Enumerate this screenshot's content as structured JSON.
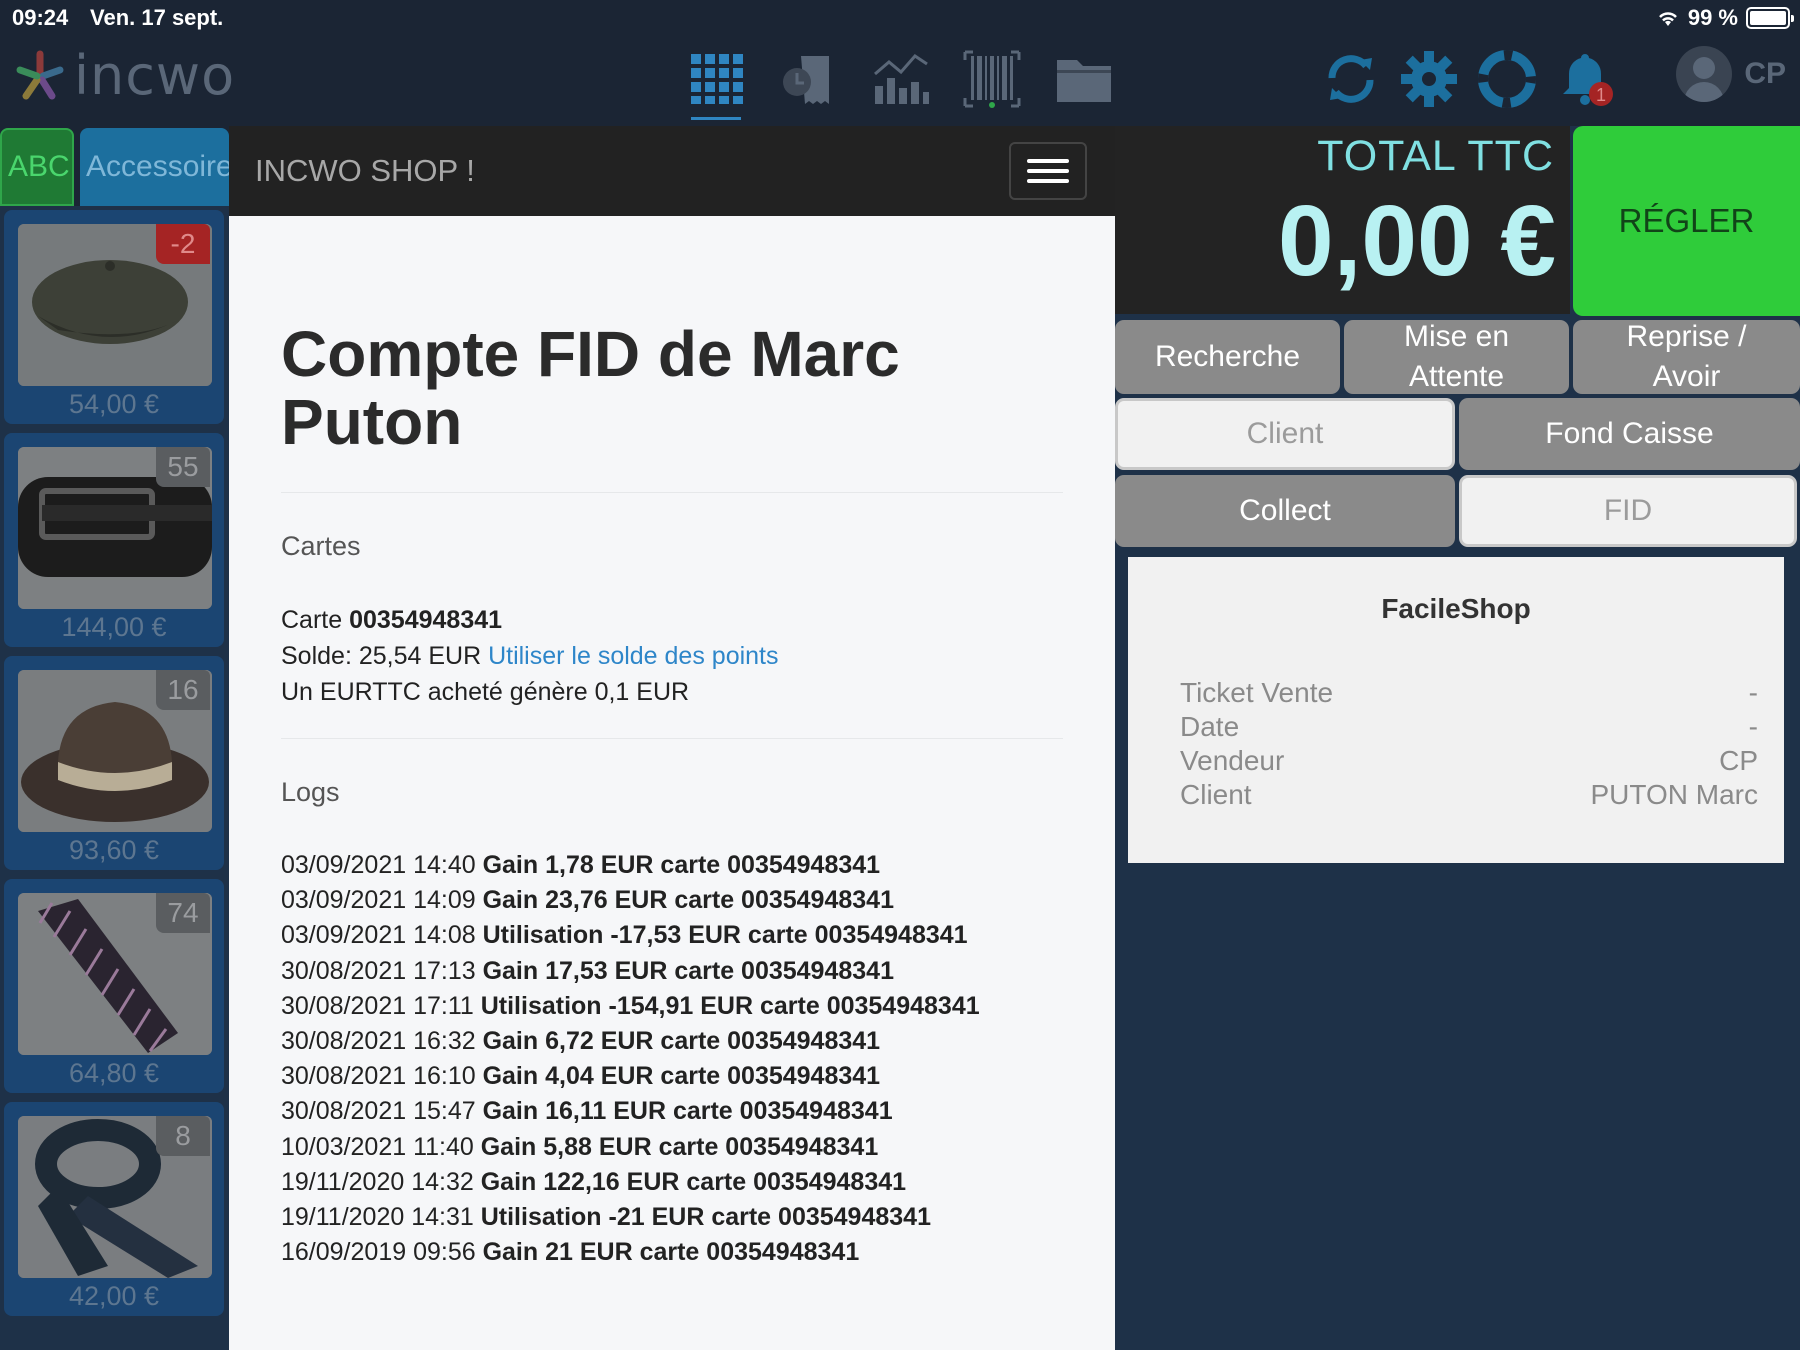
{
  "status_bar": {
    "time": "09:24",
    "date": "Ven. 17 sept.",
    "battery": "99 %"
  },
  "app": {
    "logo": "incwo",
    "user_initials": "CP",
    "notification_count": "1"
  },
  "nav_icons": [
    "grid-icon",
    "clock-receipt-icon",
    "chart-icon",
    "barcode-icon",
    "folder-icon"
  ],
  "right_icons": [
    "sync-icon",
    "gear-icon",
    "lifebuoy-icon",
    "bell-icon"
  ],
  "categories": {
    "abc": "ABC",
    "accessories": "Accessoires"
  },
  "products": [
    {
      "badge": "-2",
      "price": "54,00 €",
      "image": "cap"
    },
    {
      "badge": "55",
      "price": "144,00 €",
      "image": "belt"
    },
    {
      "badge": "16",
      "price": "93,60 €",
      "image": "hat"
    },
    {
      "badge": "74",
      "price": "64,80 €",
      "image": "tie"
    },
    {
      "badge": "8",
      "price": "42,00 €",
      "image": "scarf"
    }
  ],
  "shop_header": {
    "title": "INCWO SHOP !"
  },
  "fid": {
    "title": "Compte FID de Marc Puton",
    "cards_label": "Cartes",
    "card_prefix": "Carte ",
    "card_number": "00354948341",
    "balance_text": "Solde: 25,54 EUR ",
    "use_points_link": "Utiliser le solde des points",
    "rule": "Un EURTTC acheté génère 0,1 EUR",
    "logs_label": "Logs",
    "logs": [
      {
        "date": "03/09/2021 14:40 ",
        "text": "Gain 1,78 EUR carte 00354948341"
      },
      {
        "date": "03/09/2021 14:09 ",
        "text": "Gain 23,76 EUR carte 00354948341"
      },
      {
        "date": "03/09/2021 14:08 ",
        "text": "Utilisation -17,53 EUR carte 00354948341"
      },
      {
        "date": "30/08/2021 17:13 ",
        "text": "Gain 17,53 EUR carte 00354948341"
      },
      {
        "date": "30/08/2021 17:11 ",
        "text": "Utilisation -154,91 EUR carte 00354948341"
      },
      {
        "date": "30/08/2021 16:32 ",
        "text": "Gain 6,72 EUR carte 00354948341"
      },
      {
        "date": "30/08/2021 16:10 ",
        "text": "Gain 4,04 EUR carte 00354948341"
      },
      {
        "date": "30/08/2021 15:47 ",
        "text": "Gain 16,11 EUR carte 00354948341"
      },
      {
        "date": "10/03/2021 11:40 ",
        "text": "Gain 5,88 EUR carte 00354948341"
      },
      {
        "date": "19/11/2020 14:32 ",
        "text": "Gain 122,16 EUR carte 00354948341"
      },
      {
        "date": "19/11/2020 14:31 ",
        "text": "Utilisation -21 EUR carte 00354948341"
      },
      {
        "date": "16/09/2019 09:56 ",
        "text": "Gain 21 EUR carte 00354948341"
      }
    ]
  },
  "register": {
    "total_label": "TOTAL TTC",
    "total_amount": "0,00 €",
    "pay_button": "RÉGLER",
    "buttons": {
      "search": "Recherche",
      "hold": "Mise en Attente",
      "return": "Reprise / Avoir",
      "client": "Client",
      "float": "Fond Caisse",
      "collect": "Collect",
      "fid": "FID"
    }
  },
  "ticket": {
    "shop_name": "FacileShop",
    "rows": [
      {
        "label": "Ticket Vente",
        "value": "-"
      },
      {
        "label": "Date",
        "value": "-"
      },
      {
        "label": "Vendeur",
        "value": "CP"
      },
      {
        "label": "Client",
        "value": "PUTON Marc"
      }
    ]
  },
  "colors": {
    "pay_green": "#2fcc3a",
    "total_cyan": "#b8f1f2",
    "link_blue": "#2e86c9",
    "nav_bg": "#1b2534",
    "panel_bg": "#1e3148"
  }
}
